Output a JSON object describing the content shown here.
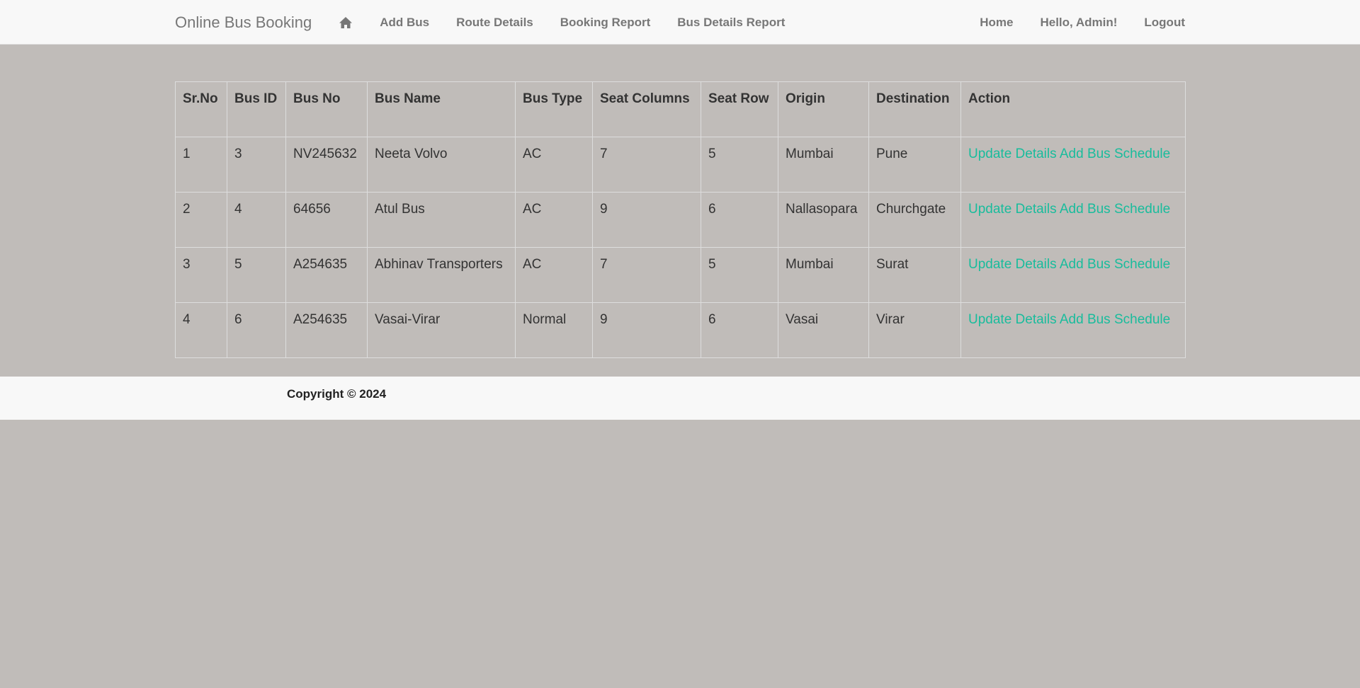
{
  "navbar": {
    "brand": "Online Bus Booking",
    "left_links": [
      {
        "label": "Add Bus"
      },
      {
        "label": "Route Details"
      },
      {
        "label": "Booking Report"
      },
      {
        "label": "Bus Details Report"
      }
    ],
    "right_links": [
      {
        "label": "Home"
      },
      {
        "label": "Hello, Admin!"
      },
      {
        "label": "Logout"
      }
    ],
    "home_icon": "home-icon"
  },
  "table": {
    "headers": [
      "Sr.No",
      "Bus ID",
      "Bus No",
      "Bus Name",
      "Bus Type",
      "Seat Columns",
      "Seat Row",
      "Origin",
      "Destination",
      "Action"
    ],
    "rows": [
      {
        "sr": "1",
        "bus_id": "3",
        "bus_no": "NV245632",
        "bus_name": "Neeta Volvo",
        "bus_type": "AC",
        "seat_columns": "7",
        "seat_row": "5",
        "origin": "Mumbai",
        "destination": "Pune",
        "action_update": "Update Details",
        "action_schedule": "Add Bus Schedule"
      },
      {
        "sr": "2",
        "bus_id": "4",
        "bus_no": "64656",
        "bus_name": "Atul Bus",
        "bus_type": "AC",
        "seat_columns": "9",
        "seat_row": "6",
        "origin": "Nallasopara",
        "destination": "Churchgate",
        "action_update": "Update Details",
        "action_schedule": "Add Bus Schedule"
      },
      {
        "sr": "3",
        "bus_id": "5",
        "bus_no": "A254635",
        "bus_name": "Abhinav Transporters",
        "bus_type": "AC",
        "seat_columns": "7",
        "seat_row": "5",
        "origin": "Mumbai",
        "destination": "Surat",
        "action_update": "Update Details",
        "action_schedule": "Add Bus Schedule"
      },
      {
        "sr": "4",
        "bus_id": "6",
        "bus_no": "A254635",
        "bus_name": "Vasai-Virar",
        "bus_type": "Normal",
        "seat_columns": "9",
        "seat_row": "6",
        "origin": "Vasai",
        "destination": "Virar",
        "action_update": "Update Details",
        "action_schedule": "Add Bus Schedule"
      }
    ]
  },
  "footer": {
    "copyright": "Copyright © 2024"
  },
  "colors": {
    "page_bg": "#c0bcb9",
    "navbar_bg": "#f8f8f8",
    "link_accent": "#18bc9c",
    "nav_text": "#777777"
  }
}
